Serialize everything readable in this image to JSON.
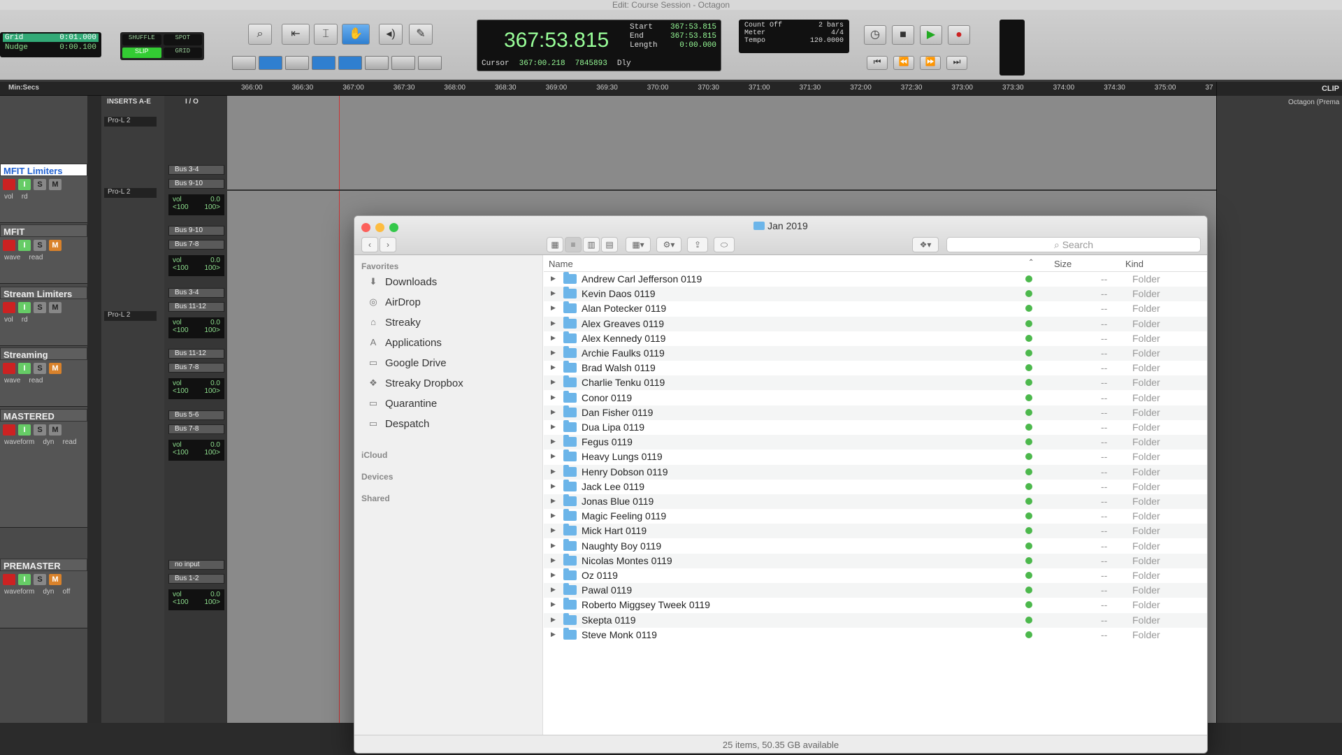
{
  "window_title": "Edit: Course Session - Octagon",
  "grid": {
    "label": "Grid",
    "value": "0:01.000"
  },
  "nudge": {
    "label": "Nudge",
    "value": "0:00.100"
  },
  "edit_modes": [
    "SHUFFLE",
    "SPOT",
    "SLIP",
    "GRID"
  ],
  "counter": {
    "main": "367:53.815",
    "start_label": "Start",
    "start": "367:53.815",
    "end_label": "End",
    "end": "367:53.815",
    "length_label": "Length",
    "length": "0:00.000",
    "cursor_label": "Cursor",
    "cursor": "367:00.218",
    "sample": "7845893",
    "dly": "Dly"
  },
  "meter": {
    "count_off": "Count Off",
    "meter_label": "Meter",
    "tempo_label": "Tempo",
    "bars": "2 bars",
    "sig": "4/4",
    "tempo": "120.0000"
  },
  "ruler": {
    "label": "Min:Secs",
    "ticks": [
      "366:00",
      "366:30",
      "367:00",
      "367:30",
      "368:00",
      "368:30",
      "369:00",
      "369:30",
      "370:00",
      "370:30",
      "371:00",
      "371:30",
      "372:00",
      "372:30",
      "373:00",
      "373:30",
      "374:00",
      "374:30",
      "375:00",
      "37"
    ]
  },
  "columns": {
    "inserts": "INSERTS A-E",
    "io": "I / O"
  },
  "clips_panel": {
    "title": "CLIP",
    "item": "Octagon (Prema"
  },
  "tracks": [
    {
      "name": "MFIT Limiters",
      "insert": "Pro-L 2",
      "io1": "Bus 3-4",
      "io2": "Bus 9-10",
      "vol": "vol",
      "vol_val": "0.0",
      "pan_l": "<100",
      "pan_r": "100>",
      "mode1": "vol",
      "mode2": "rd"
    },
    {
      "name": "MFIT",
      "insert": "",
      "io1": "Bus 9-10",
      "io2": "Bus 7-8",
      "vol": "vol",
      "vol_val": "0.0",
      "pan_l": "<100",
      "pan_r": "100>",
      "mode1": "wave",
      "mode2": "read"
    },
    {
      "name": "Stream Limiters",
      "insert": "Pro-L 2",
      "io1": "Bus 3-4",
      "io2": "Bus 11-12",
      "vol": "vol",
      "vol_val": "0.0",
      "pan_l": "<100",
      "pan_r": "100>",
      "mode1": "vol",
      "mode2": "rd"
    },
    {
      "name": "Streaming",
      "insert": "",
      "io1": "Bus 11-12",
      "io2": "Bus 7-8",
      "vol": "vol",
      "vol_val": "0.0",
      "pan_l": "<100",
      "pan_r": "100>",
      "mode1": "wave",
      "mode2": "read"
    },
    {
      "name": "MASTERED",
      "insert": "",
      "io1": "Bus 5-6",
      "io2": "Bus 7-8",
      "vol": "vol",
      "vol_val": "0.0",
      "pan_l": "<100",
      "pan_r": "100>",
      "mode1": "waveform",
      "mode2": "dyn",
      "mode3": "read"
    },
    {
      "name": "PREMASTER",
      "insert": "",
      "io1": "no input",
      "io2": "Bus 1-2",
      "vol": "vol",
      "vol_val": "0.0",
      "pan_l": "<100",
      "pan_r": "100>",
      "mode1": "waveform",
      "mode2": "dyn",
      "mode3": "off"
    }
  ],
  "track_buttons": {
    "s": "S",
    "m": "M",
    "i": "I"
  },
  "top_insert": "Pro-L 2",
  "finder": {
    "title": "Jan 2019",
    "search_placeholder": "Search",
    "sidebar": {
      "favorites_label": "Favorites",
      "favorites": [
        {
          "label": "Downloads",
          "icon": "downloads-icon"
        },
        {
          "label": "AirDrop",
          "icon": "airdrop-icon"
        },
        {
          "label": "Streaky",
          "icon": "home-icon"
        },
        {
          "label": "Applications",
          "icon": "applications-icon"
        },
        {
          "label": "Google Drive",
          "icon": "folder-icon"
        },
        {
          "label": "Streaky Dropbox",
          "icon": "dropbox-icon"
        },
        {
          "label": "Quarantine",
          "icon": "folder-icon"
        },
        {
          "label": "Despatch",
          "icon": "folder-icon"
        }
      ],
      "icloud_label": "iCloud",
      "devices_label": "Devices",
      "shared_label": "Shared"
    },
    "columns": {
      "name": "Name",
      "size": "Size",
      "kind": "Kind"
    },
    "rows": [
      {
        "name": "Andrew Carl Jefferson 0119",
        "size": "--",
        "kind": "Folder"
      },
      {
        "name": "Kevin Daos 0119",
        "size": "--",
        "kind": "Folder"
      },
      {
        "name": "Alan Potecker 0119",
        "size": "--",
        "kind": "Folder"
      },
      {
        "name": "Alex Greaves 0119",
        "size": "--",
        "kind": "Folder"
      },
      {
        "name": "Alex Kennedy 0119",
        "size": "--",
        "kind": "Folder"
      },
      {
        "name": "Archie Faulks 0119",
        "size": "--",
        "kind": "Folder"
      },
      {
        "name": "Brad Walsh 0119",
        "size": "--",
        "kind": "Folder"
      },
      {
        "name": "Charlie Tenku 0119",
        "size": "--",
        "kind": "Folder"
      },
      {
        "name": "Conor 0119",
        "size": "--",
        "kind": "Folder"
      },
      {
        "name": "Dan Fisher 0119",
        "size": "--",
        "kind": "Folder"
      },
      {
        "name": "Dua Lipa 0119",
        "size": "--",
        "kind": "Folder"
      },
      {
        "name": "Fegus 0119",
        "size": "--",
        "kind": "Folder"
      },
      {
        "name": "Heavy Lungs 0119",
        "size": "--",
        "kind": "Folder"
      },
      {
        "name": "Henry Dobson 0119",
        "size": "--",
        "kind": "Folder"
      },
      {
        "name": "Jack Lee 0119",
        "size": "--",
        "kind": "Folder"
      },
      {
        "name": "Jonas Blue 0119",
        "size": "--",
        "kind": "Folder"
      },
      {
        "name": "Magic Feeling 0119",
        "size": "--",
        "kind": "Folder"
      },
      {
        "name": "Mick Hart 0119",
        "size": "--",
        "kind": "Folder"
      },
      {
        "name": "Naughty Boy 0119",
        "size": "--",
        "kind": "Folder"
      },
      {
        "name": "Nicolas Montes 0119",
        "size": "--",
        "kind": "Folder"
      },
      {
        "name": "Oz 0119",
        "size": "--",
        "kind": "Folder"
      },
      {
        "name": "Pawal 0119",
        "size": "--",
        "kind": "Folder"
      },
      {
        "name": "Roberto Miggsey Tweek 0119",
        "size": "--",
        "kind": "Folder"
      },
      {
        "name": "Skepta 0119",
        "size": "--",
        "kind": "Folder"
      },
      {
        "name": "Steve Monk 0119",
        "size": "--",
        "kind": "Folder"
      }
    ],
    "status": "25 items, 50.35 GB available"
  },
  "colors": {
    "accent": "#2f7fd0",
    "folder": "#6cb5e9",
    "sync_check": "#4cb84c"
  }
}
